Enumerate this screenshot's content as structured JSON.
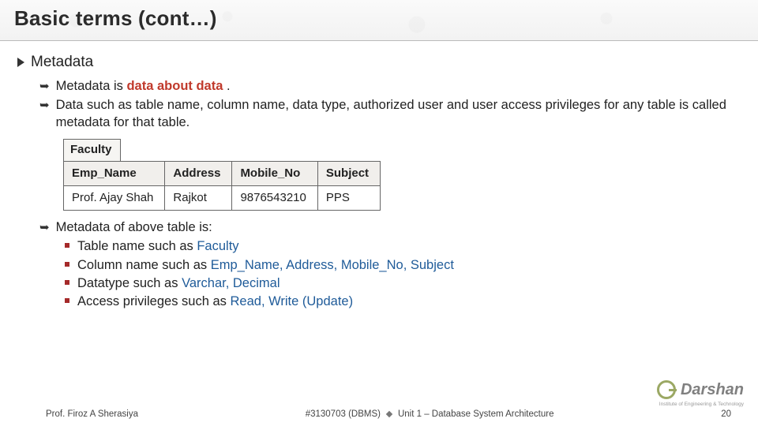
{
  "title": "Basic terms (cont…)",
  "h1": "Metadata",
  "b1": {
    "prefix": "Metadata is ",
    "bold": "data about data",
    "suffix": " ."
  },
  "b2": "Data such as table name, column name, data type, authorized user and user access privileges for any table is called metadata for that table.",
  "table": {
    "name": "Faculty",
    "headers": [
      "Emp_Name",
      "Address",
      "Mobile_No",
      "Subject"
    ],
    "row": [
      "Prof. Ajay Shah",
      "Rajkot",
      "9876543210",
      "PPS"
    ]
  },
  "b3": "Metadata of above table is:",
  "sub": [
    {
      "pre": "Table name such as ",
      "blue": "Faculty"
    },
    {
      "pre": "Column name such as ",
      "blue": "Emp_Name, Address, Mobile_No, Subject"
    },
    {
      "pre": "Datatype  such as ",
      "blue": "Varchar, Decimal"
    },
    {
      "pre": "Access privileges such as ",
      "blue": "Read, Write (Update)"
    }
  ],
  "footer": {
    "left": "Prof. Firoz A Sherasiya",
    "code": "#3130703 (DBMS)",
    "unit": "Unit 1 – Database System Architecture",
    "page": "20"
  },
  "logo": {
    "text": "Darshan",
    "sub": "Institute of Engineering & Technology"
  }
}
